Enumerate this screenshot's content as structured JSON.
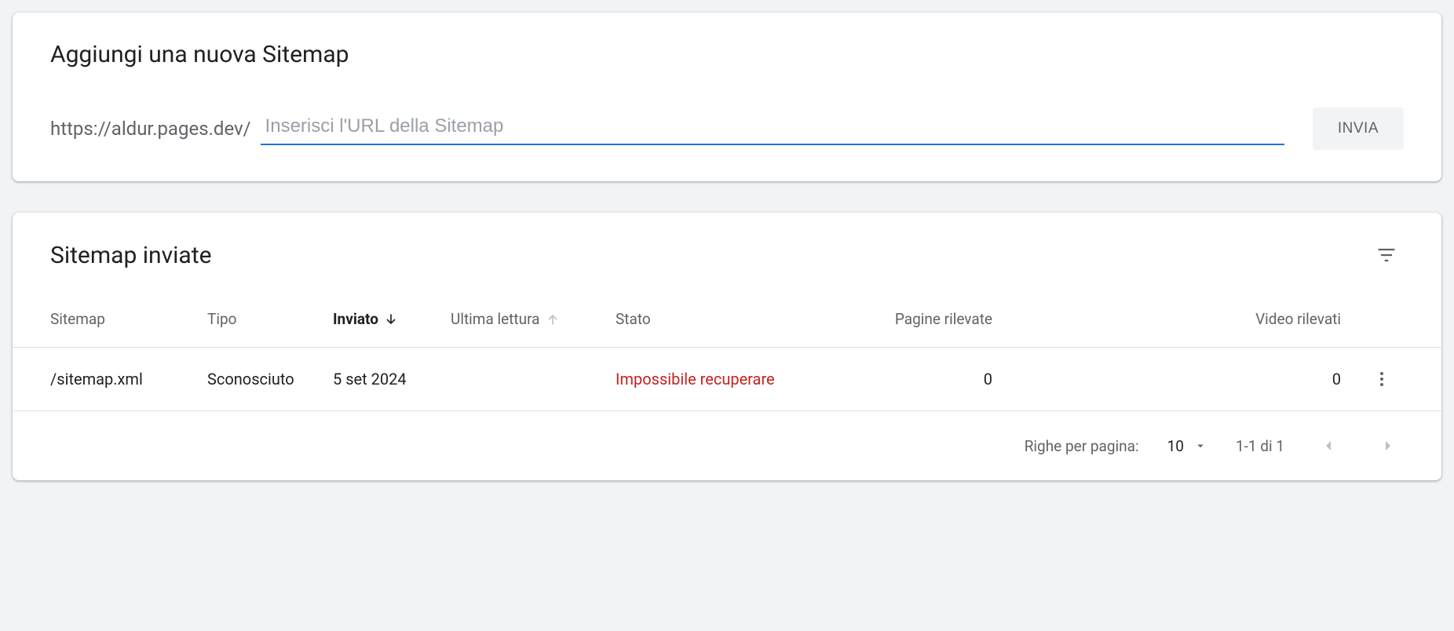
{
  "add": {
    "title": "Aggiungi una nuova Sitemap",
    "url_prefix": "https://aldur.pages.dev/",
    "placeholder": "Inserisci l'URL della Sitemap",
    "submit": "INVIA"
  },
  "list": {
    "title": "Sitemap inviate",
    "columns": {
      "sitemap": "Sitemap",
      "tipo": "Tipo",
      "inviato": "Inviato",
      "ultima": "Ultima lettura",
      "stato": "Stato",
      "pagine": "Pagine rilevate",
      "video": "Video rilevati"
    },
    "rows": [
      {
        "sitemap": "/sitemap.xml",
        "tipo": "Sconosciuto",
        "inviato": "5 set 2024",
        "ultima": "",
        "stato": "Impossibile recuperare",
        "pagine": "0",
        "video": "0"
      }
    ],
    "pagination": {
      "rows_label": "Righe per pagina:",
      "rows_value": "10",
      "range": "1-1 di 1"
    }
  }
}
